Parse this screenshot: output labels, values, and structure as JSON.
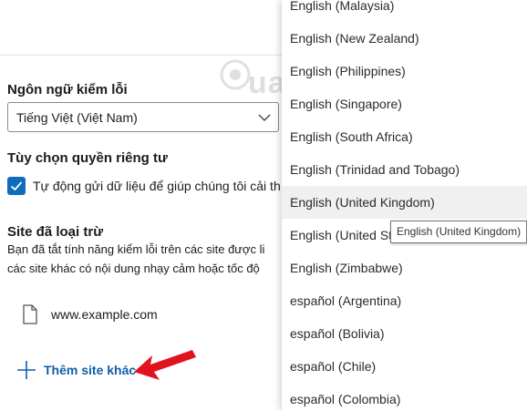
{
  "settings": {
    "language_heading": "Ngôn ngữ kiểm lỗi",
    "language_select_value": "Tiếng Việt (Việt Nam)",
    "privacy_heading": "Tùy chọn quyền riêng tư",
    "privacy_checkbox_label": "Tự động gửi dữ liệu để giúp chúng tôi cải th",
    "privacy_checked": true,
    "excluded_heading": "Site đã loại trừ",
    "excluded_desc_line1": "Bạn đã tắt tính năng kiểm lỗi trên các site được li",
    "excluded_desc_line2": "các site khác có nội dung nhạy cảm hoặc tốc độ",
    "excluded_site": "www.example.com",
    "add_site_label": "Thêm site khác"
  },
  "dropdown": {
    "options": [
      "English (Malaysia)",
      "English (New Zealand)",
      "English (Philippines)",
      "English (Singapore)",
      "English (South Africa)",
      "English (Trinidad and Tobago)",
      "English (United Kingdom)",
      "English (United St",
      "English (Zimbabwe)",
      "español (Argentina)",
      "español (Bolivia)",
      "español (Chile)",
      "español (Colombia)"
    ],
    "hovered_option": "English (United Kingdom)",
    "tooltip": "English (United Kingdom)"
  },
  "watermark": {
    "text": "uantrimang"
  },
  "colors": {
    "accent": "#0f6cbd",
    "link": "#0f5fa8",
    "arrow": "#e0141e"
  }
}
